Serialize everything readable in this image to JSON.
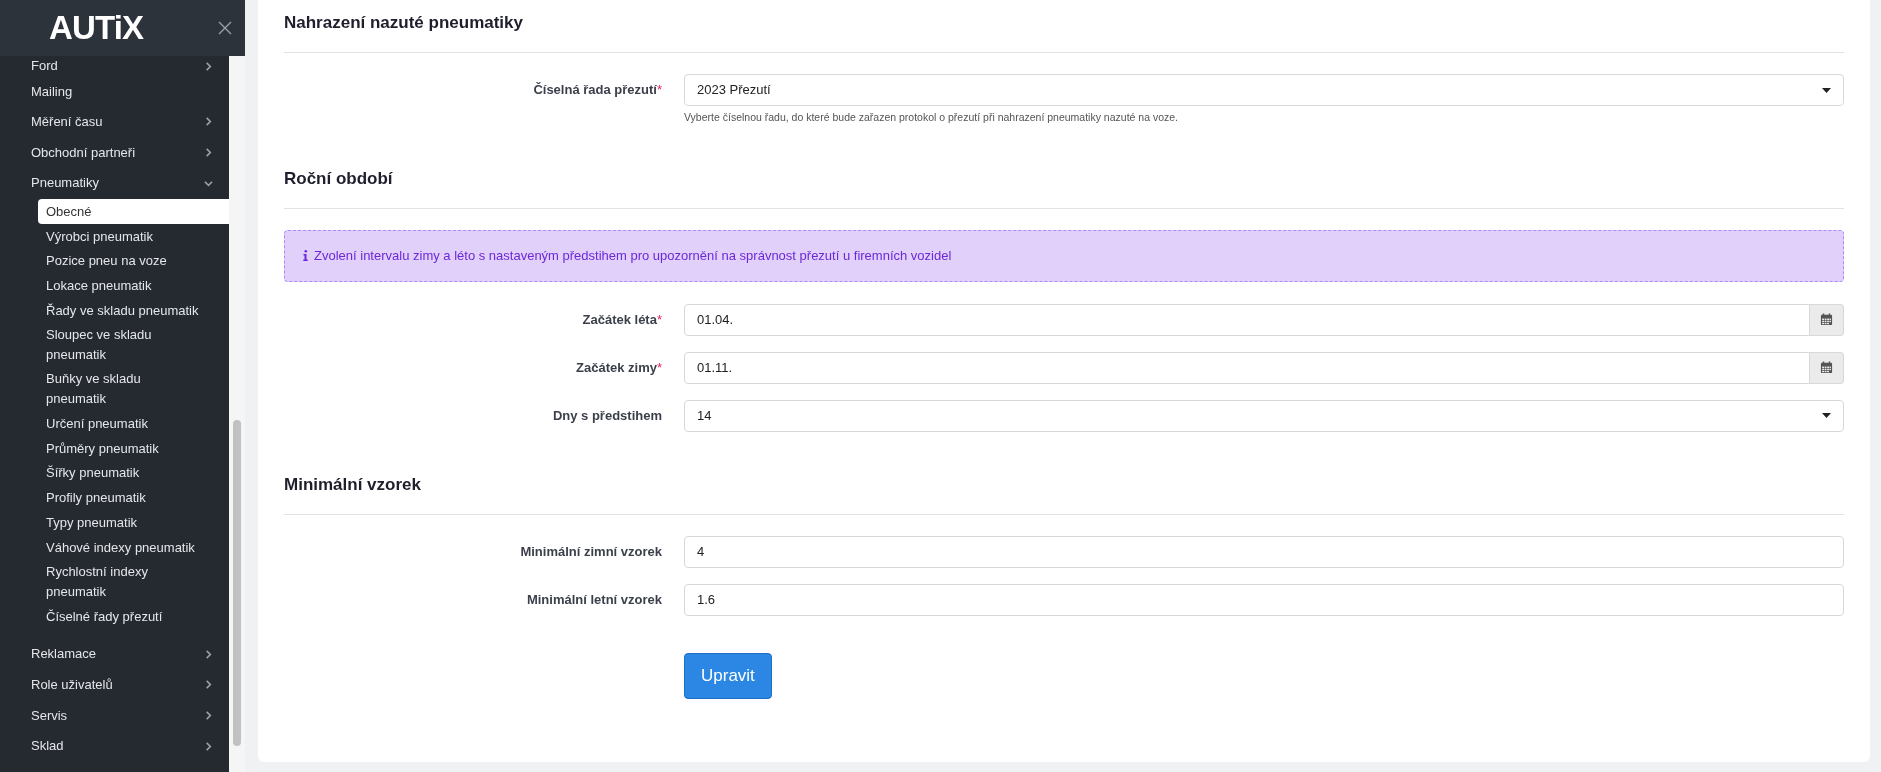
{
  "brand": "AUTiX",
  "sidebar": {
    "items": [
      {
        "label": "Ford",
        "expandable": true,
        "expanded": false
      },
      {
        "label": "Mailing",
        "expandable": false
      },
      {
        "label": "Měření času",
        "expandable": true,
        "expanded": false
      },
      {
        "label": "Obchodní partneři",
        "expandable": true,
        "expanded": false
      },
      {
        "label": "Pneumatiky",
        "expandable": true,
        "expanded": true,
        "children": [
          {
            "label": "Obecné",
            "selected": true
          },
          {
            "label": "Výrobci pneumatik",
            "selected": false
          },
          {
            "label": "Pozice pneu na voze",
            "selected": false
          },
          {
            "label": "Lokace pneumatik",
            "selected": false
          },
          {
            "label": "Řady ve skladu pneumatik",
            "selected": false
          },
          {
            "label": "Sloupec ve skladu pneumatik",
            "selected": false
          },
          {
            "label": "Buňky ve skladu pneumatik",
            "selected": false
          },
          {
            "label": "Určení pneumatik",
            "selected": false
          },
          {
            "label": "Průměry pneumatik",
            "selected": false
          },
          {
            "label": "Šířky pneumatik",
            "selected": false
          },
          {
            "label": "Profily pneumatik",
            "selected": false
          },
          {
            "label": "Typy pneumatik",
            "selected": false
          },
          {
            "label": "Váhové indexy pneumatik",
            "selected": false
          },
          {
            "label": "Rychlostní indexy pneumatik",
            "selected": false
          },
          {
            "label": "Číselné řady přezutí",
            "selected": false
          }
        ]
      },
      {
        "label": "Reklamace",
        "expandable": true,
        "expanded": false
      },
      {
        "label": "Role uživatelů",
        "expandable": true,
        "expanded": false
      },
      {
        "label": "Servis",
        "expandable": true,
        "expanded": false
      },
      {
        "label": "Sklad",
        "expandable": true,
        "expanded": false
      }
    ]
  },
  "sections": [
    {
      "title": "Nahrazení nazuté pneumatiky",
      "fields": [
        {
          "label": "Číselná řada přezutí",
          "required_mark": "*",
          "kind": "select",
          "value": "2023 Přezutí",
          "help": "Vyberte číselnou řadu, do které bude zařazen protokol o přezutí při nahrazení pneumatiky nazuté na voze."
        }
      ]
    },
    {
      "title": "Roční období",
      "alert": "Zvolení intervalu zimy a léto s nastaveným předstihem pro upozornění na správnost přezutí u firemních vozidel",
      "fields": [
        {
          "label": "Začátek léta",
          "required_mark": "*",
          "kind": "date",
          "value": "01.04."
        },
        {
          "label": "Začátek zimy",
          "required_mark": "*",
          "kind": "date",
          "value": "01.11."
        },
        {
          "label": "Dny s předstihem",
          "kind": "select",
          "value": "14"
        }
      ]
    },
    {
      "title": "Minimální vzorek",
      "fields": [
        {
          "label": "Minimální zimní vzorek",
          "kind": "text",
          "value": "4"
        },
        {
          "label": "Minimální letní vzorek",
          "kind": "text",
          "value": "1.6"
        }
      ]
    }
  ],
  "submit": "Upravit"
}
